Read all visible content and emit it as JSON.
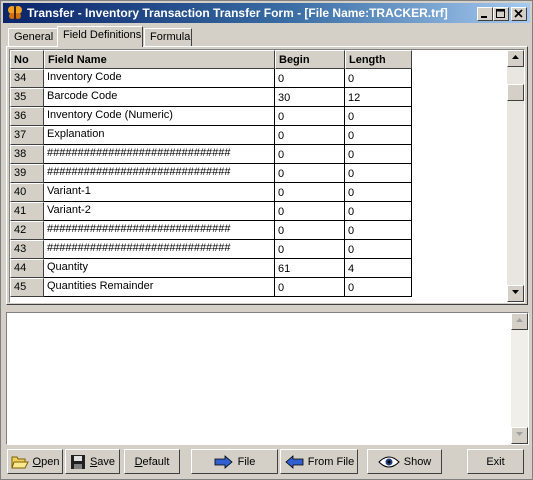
{
  "window": {
    "title": "Transfer - Inventory Transaction Transfer Form - [File Name:TRACKER.trf]",
    "icon": "butterfly-icon",
    "controls": [
      "minimize-icon",
      "maximize-icon",
      "close-icon"
    ]
  },
  "tabs": [
    {
      "label": "General",
      "active": false
    },
    {
      "label": "Field Definitions",
      "active": true
    },
    {
      "label": "Formula",
      "active": false
    }
  ],
  "grid": {
    "headers": [
      "No",
      "Field Name",
      "Begin",
      "Length"
    ],
    "rows": [
      {
        "no": "34",
        "name": "Inventory Code",
        "begin": "0",
        "length": "0"
      },
      {
        "no": "35",
        "name": "Barcode Code",
        "begin": "30",
        "length": "12"
      },
      {
        "no": "36",
        "name": "Inventory Code (Numeric)",
        "begin": "0",
        "length": "0"
      },
      {
        "no": "37",
        "name": "Explanation",
        "begin": "0",
        "length": "0"
      },
      {
        "no": "38",
        "name": "##############################",
        "begin": "0",
        "length": "0"
      },
      {
        "no": "39",
        "name": "##############################",
        "begin": "0",
        "length": "0"
      },
      {
        "no": "40",
        "name": "Variant-1",
        "begin": "0",
        "length": "0"
      },
      {
        "no": "41",
        "name": "Variant-2",
        "begin": "0",
        "length": "0"
      },
      {
        "no": "42",
        "name": "##############################",
        "begin": "0",
        "length": "0"
      },
      {
        "no": "43",
        "name": "##############################",
        "begin": "0",
        "length": "0"
      },
      {
        "no": "44",
        "name": "Quantity",
        "begin": "61",
        "length": "4"
      },
      {
        "no": "45",
        "name": "Quantities Remainder",
        "begin": "0",
        "length": "0"
      }
    ]
  },
  "memo": {
    "text": ""
  },
  "buttons": {
    "open": {
      "label": "Open",
      "mnemonic": "O",
      "rest": "pen",
      "icon": "folder-open-icon"
    },
    "save": {
      "label": "Save",
      "mnemonic": "S",
      "rest": "ave",
      "icon": "floppy-disk-icon"
    },
    "default": {
      "label": "Default",
      "mnemonic": "D",
      "rest": "efault"
    },
    "file": {
      "label": "File",
      "icon": "arrow-right-icon"
    },
    "from_file": {
      "label": "From File",
      "icon": "arrow-left-icon"
    },
    "show": {
      "label": "Show",
      "icon": "eye-icon"
    },
    "exit": {
      "label": "Exit"
    }
  }
}
